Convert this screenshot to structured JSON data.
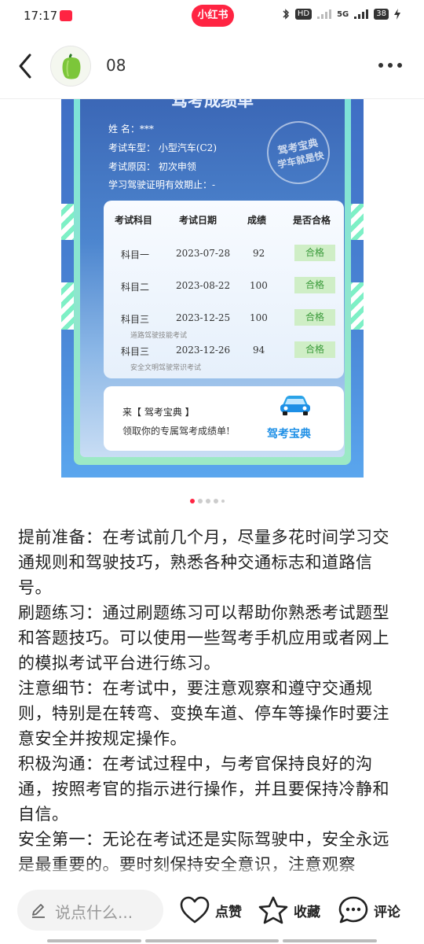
{
  "status_bar": {
    "time": "17:17",
    "app_pill": "小红书",
    "network": "HD",
    "network_sub": "5G",
    "battery": "38"
  },
  "header": {
    "author_name": "08",
    "back_icon": "chevron-left-icon",
    "more_icon": "more-icon"
  },
  "image_card": {
    "title": "驾考成绩单",
    "info_lines": [
      "姓  名：***",
      "考试车型： 小型汽车(C2)",
      "考试原因： 初次申领",
      "学习驾驶证明有效期止：-"
    ],
    "stamp_line1": "驾考宝典",
    "stamp_line2": "学车就是快",
    "table": {
      "headers": [
        "考试科目",
        "考试日期",
        "成绩",
        "是否合格"
      ],
      "rows": [
        {
          "subject": "科目一",
          "date": "2023-07-28",
          "score": "92",
          "result": "合格",
          "note": ""
        },
        {
          "subject": "科目二",
          "date": "2023-08-22",
          "score": "100",
          "result": "合格",
          "note": ""
        },
        {
          "subject": "科目三",
          "date": "2023-12-25",
          "score": "100",
          "result": "合格",
          "note": "道路驾驶技能考试"
        },
        {
          "subject": "科目三",
          "date": "2023-12-26",
          "score": "94",
          "result": "合格",
          "note": "安全文明驾驶常识考试"
        }
      ]
    },
    "promo_line1": "来【 驾考宝典 】",
    "promo_line2": "领取你的专属驾考成绩单!",
    "promo_brand": "驾考宝典"
  },
  "carousel": {
    "current": 1,
    "total": 5
  },
  "post_text": [
    "提前准备：在考试前几个月，尽量多花时间学习交通规则和驾驶技巧，熟悉各种交通标志和道路信号。",
    "刷题练习：通过刷题练习可以帮助你熟悉考试题型和答题技巧。可以使用一些驾考手机应用或者网上的模拟考试平台进行练习。",
    "注意细节：在考试中，要注意观察和遵守交通规则，特别是在转弯、变换车道、停车等操作时要注意安全并按规定操作。",
    "积极沟通：在考试过程中，与考官保持良好的沟通，按照考官的指示进行操作，并且要保持冷静和自信。",
    "安全第一：无论在考试还是实际驾驶中，安全永远是最重要的。要时刻保持安全意识，注意观察"
  ],
  "bottom_bar": {
    "comment_placeholder": "说点什么...",
    "like_label": "点赞",
    "collect_label": "收藏",
    "comment_label": "评论"
  },
  "colors": {
    "brand_red": "#ff2442",
    "pass_green": "#3a9a3a"
  }
}
